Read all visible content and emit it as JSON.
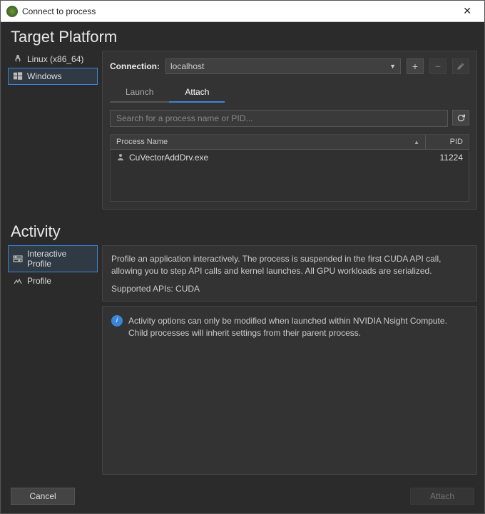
{
  "window": {
    "title": "Connect to process"
  },
  "sections": {
    "target": "Target Platform",
    "activity": "Activity"
  },
  "platforms": {
    "items": [
      {
        "label": "Linux (x86_64)"
      },
      {
        "label": "Windows"
      }
    ],
    "selected": 1
  },
  "connection": {
    "label": "Connection:",
    "value": "localhost"
  },
  "tabs": {
    "items": [
      "Launch",
      "Attach"
    ],
    "active": 1
  },
  "search": {
    "placeholder": "Search for a process name or PID..."
  },
  "process_table": {
    "columns": {
      "name": "Process Name",
      "pid": "PID"
    },
    "rows": [
      {
        "name": "CuVectorAddDrv.exe",
        "pid": "11224"
      }
    ]
  },
  "activities": {
    "items": [
      {
        "label": "Interactive Profile"
      },
      {
        "label": "Profile"
      }
    ],
    "selected": 0
  },
  "activity_desc": "Profile an application interactively. The process is suspended in the first CUDA API call, allowing you to step API calls and kernel launches. All GPU workloads are serialized.",
  "supported_apis": "Supported APIs: CUDA",
  "info_message": "Activity options can only be modified when launched within NVIDIA Nsight Compute. Child processes will inherit settings from their parent process.",
  "buttons": {
    "cancel": "Cancel",
    "attach": "Attach"
  }
}
